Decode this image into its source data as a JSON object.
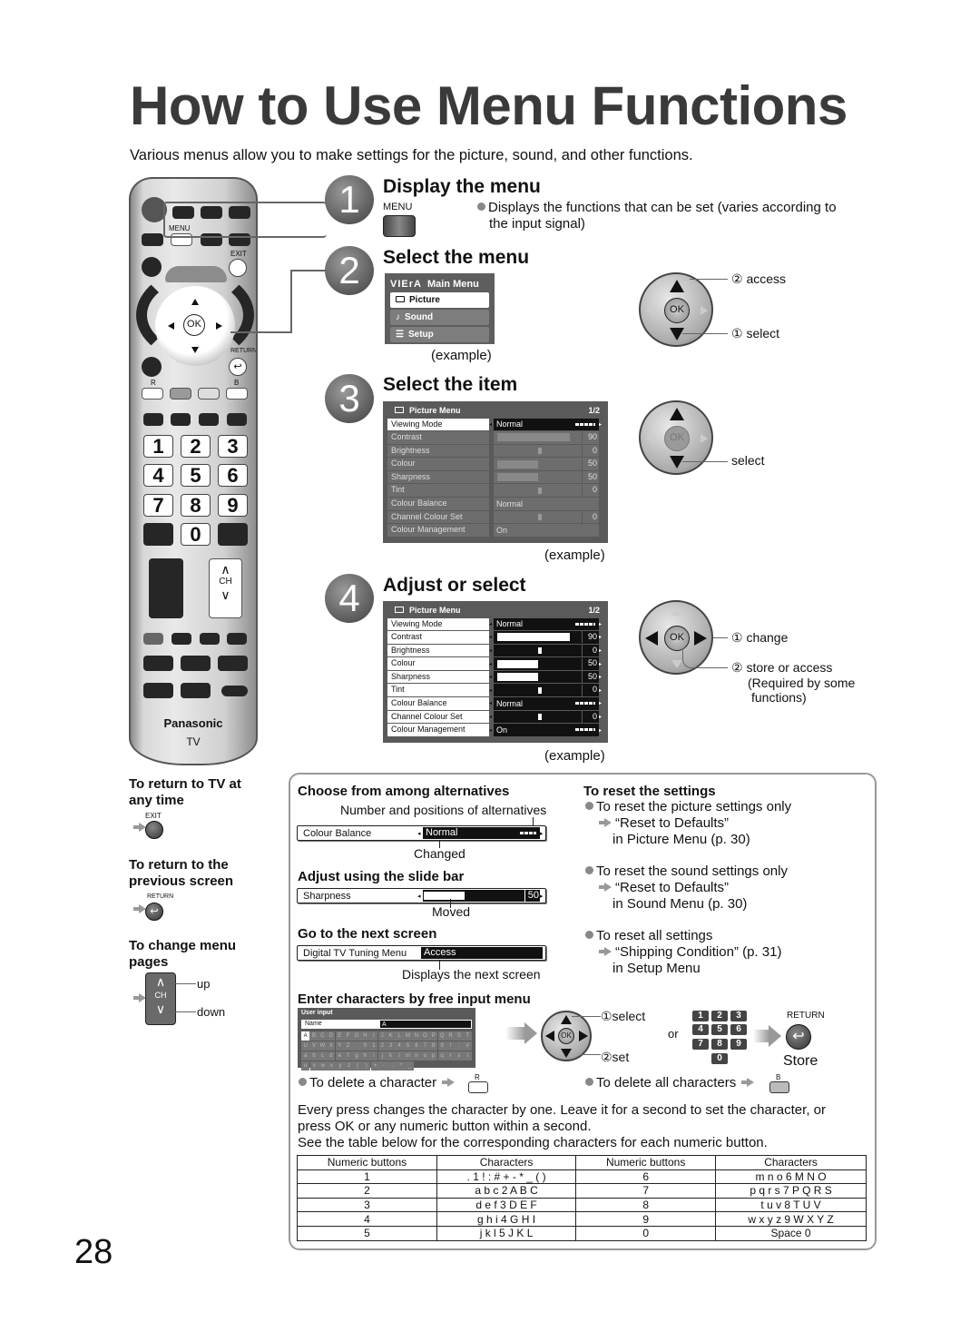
{
  "title": "How to Use Menu Functions",
  "intro": "Various menus allow you to make settings for the picture, sound, and other functions.",
  "page_number": "28",
  "remote": {
    "menu_label": "MENU",
    "exit_label": "EXIT",
    "return_label": "RETURN",
    "ok_label": "OK",
    "r_label": "R",
    "b_label": "B",
    "numbers": [
      "1",
      "2",
      "3",
      "4",
      "5",
      "6",
      "7",
      "8",
      "9",
      "0"
    ],
    "ch_label": "CH",
    "brand": "Panasonic",
    "model": "TV"
  },
  "steps": [
    {
      "number": "1",
      "heading": "Display the menu",
      "key_label": "MENU",
      "bullet": "Displays the functions that can be set (varies according to",
      "bullet_cont": "the input signal)"
    },
    {
      "number": "2",
      "heading": "Select the menu",
      "main_menu": {
        "brand": "VIErA",
        "title": "Main Menu",
        "items": [
          {
            "icon": "picture-icon",
            "label": "Picture",
            "selected": true
          },
          {
            "icon": "sound-icon",
            "label": "Sound",
            "selected": false
          },
          {
            "icon": "setup-icon",
            "label": "Setup",
            "selected": false
          }
        ]
      },
      "example": "(example)",
      "callouts": [
        "② access",
        "① select"
      ]
    },
    {
      "number": "3",
      "heading": "Select the item",
      "example": "(example)",
      "callout": "select"
    },
    {
      "number": "4",
      "heading": "Adjust or select",
      "example": "(example)",
      "callouts": [
        "① change",
        "② store or access",
        "(Required by some",
        "functions)"
      ]
    }
  ],
  "picture_menu": {
    "title": "Picture Menu",
    "page": "1/2",
    "rows": [
      {
        "label": "Viewing Mode",
        "type": "choice",
        "value": "Normal"
      },
      {
        "label": "Contrast",
        "type": "bar",
        "value": "90",
        "level": 0.9
      },
      {
        "label": "Brightness",
        "type": "center",
        "value": "0"
      },
      {
        "label": "Colour",
        "type": "bar",
        "value": "50",
        "level": 0.5
      },
      {
        "label": "Sharpness",
        "type": "bar",
        "value": "50",
        "level": 0.5
      },
      {
        "label": "Tint",
        "type": "center",
        "value": "0"
      },
      {
        "label": "Colour Balance",
        "type": "choice",
        "value": "Normal"
      },
      {
        "label": "Channel Colour Set",
        "type": "center",
        "value": "0"
      },
      {
        "label": "Colour Management",
        "type": "choice",
        "value": "On"
      }
    ]
  },
  "left_tips": [
    {
      "heading": "To return to TV at any time",
      "key": "EXIT"
    },
    {
      "heading": "To return to the previous screen",
      "key": "RETURN"
    },
    {
      "heading": "To change menu pages",
      "key": "CH",
      "up": "up",
      "down": "down"
    }
  ],
  "notes": {
    "choose": {
      "heading": "Choose from among alternatives",
      "top_callout": "Number and positions of alternatives",
      "row_label": "Colour Balance",
      "row_value": "Normal",
      "bottom_callout": "Changed"
    },
    "slide": {
      "heading": "Adjust using the slide bar",
      "row_label": "Sharpness",
      "row_value": "50",
      "level": 0.5,
      "callout": "Moved"
    },
    "next": {
      "heading": "Go to the next screen",
      "row_label": "Digital TV Tuning Menu",
      "row_value": "Access",
      "callout": "Displays the next screen"
    },
    "reset": {
      "heading": "To reset the settings",
      "items": [
        {
          "bullet": "To reset the picture settings only",
          "target": "“Reset to Defaults”",
          "where": "in Picture Menu (p. 30)"
        },
        {
          "bullet": "To reset the sound settings only",
          "target": "“Reset to Defaults”",
          "where": "in Sound Menu (p. 30)"
        },
        {
          "bullet": "To reset all settings",
          "target": "“Shipping Condition” (p. 31)",
          "where": "in Setup Menu"
        }
      ]
    },
    "free_input": {
      "heading": "Enter characters by free input menu",
      "screen_title": "User input",
      "name_label": "Name",
      "name_value": "A",
      "keyboard": [
        [
          "A",
          "B",
          "C",
          "D",
          "E",
          "F",
          "G",
          "H",
          "I",
          "J",
          "K",
          "L",
          "M",
          "N",
          "O",
          "P",
          "Q",
          "R",
          "S",
          "T"
        ],
        [
          "U",
          "V",
          "W",
          "X",
          "Y",
          "Z",
          " ",
          "0",
          "1",
          "2",
          "3",
          "4",
          "5",
          "6",
          "7",
          "8",
          "9",
          "!",
          ":",
          "#"
        ],
        [
          "a",
          "b",
          "c",
          "d",
          "e",
          "f",
          "g",
          "h",
          "i",
          "j",
          "k",
          "l",
          "m",
          "n",
          "o",
          "p",
          "q",
          "r",
          "s",
          "t"
        ],
        [
          "u",
          "v",
          "w",
          "x",
          "y",
          "z",
          "(",
          ")",
          "+",
          "-",
          ".",
          "*",
          "_"
        ]
      ],
      "select_label": "①select",
      "set_label": "②set",
      "or": "or",
      "return_label": "RETURN",
      "store": "Store",
      "delete_char": "To delete a character",
      "delete_char_key": "R",
      "delete_all": "To delete all characters",
      "delete_all_key": "B"
    },
    "paragraph": [
      "Every press changes the character by one. Leave it for a second to set the character, or",
      "press OK or any numeric button within a second.",
      "See the table below for the corresponding characters for each numeric button."
    ],
    "table": {
      "headers": [
        "Numeric buttons",
        "Characters",
        "Numeric buttons",
        "Characters"
      ],
      "rows": [
        [
          "1",
          ". 1 ! : # + - * _ ( )",
          "6",
          "m n o 6 M N O"
        ],
        [
          "2",
          "a b c 2 A B C",
          "7",
          "p q r s 7 P Q R S"
        ],
        [
          "3",
          "d e f 3 D E F",
          "8",
          "t u v 8 T U V"
        ],
        [
          "4",
          "g h i 4 G H I",
          "9",
          "w x y z 9 W X Y Z"
        ],
        [
          "5",
          "j k l 5 J K L",
          "0",
          "Space 0"
        ]
      ]
    }
  }
}
